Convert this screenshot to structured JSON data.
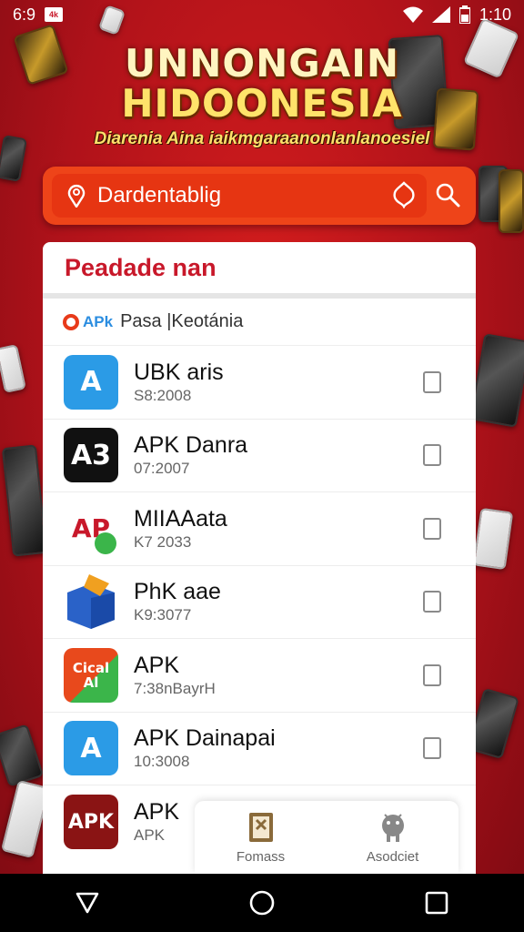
{
  "status_bar": {
    "left_text": "6:9",
    "app_badge": "4k",
    "time": "1:10"
  },
  "banner": {
    "title_line1": "UNNONGAIN",
    "title_line2": "HIDOONESIA",
    "subtitle": "Diarenia Aina iaikmgaraanonlanlanoesiel"
  },
  "search": {
    "placeholder": "Dardentablig"
  },
  "card": {
    "title": "Peadade nan",
    "source": {
      "logo_text": "APk",
      "label": "Pasa |Keotánia"
    },
    "apps": [
      {
        "name": "UBK aris",
        "meta": "S8:2008",
        "icon_text": "A",
        "icon_color": "#2b9be6"
      },
      {
        "name": "APK Danra",
        "meta": "07:2007",
        "icon_text": "A3",
        "icon_color": "#111111"
      },
      {
        "name": "MIIAAata",
        "meta": "K7 2033",
        "icon_text": "AP",
        "icon_color": "#ffffff"
      },
      {
        "name": "PhK aae",
        "meta": "K9:3077",
        "icon_text": "",
        "icon_color": "#2a62c8"
      },
      {
        "name": "APK",
        "meta": "7:38nBayrH",
        "icon_text": "Cical Al",
        "icon_color": "#e8491c"
      },
      {
        "name": "APK Dainapai",
        "meta": "10:3008",
        "icon_text": "A",
        "icon_color": "#2b9be6"
      },
      {
        "name": "APK",
        "meta": "APK",
        "icon_text": "APK",
        "icon_color": "#8a1414"
      }
    ]
  },
  "mini_tabs": [
    {
      "label": "Fomass",
      "icon": "folder-icon"
    },
    {
      "label": "Asodciet",
      "icon": "android-icon"
    }
  ],
  "nav": {
    "back": "back-icon",
    "home": "home-icon",
    "recents": "recents-icon"
  }
}
